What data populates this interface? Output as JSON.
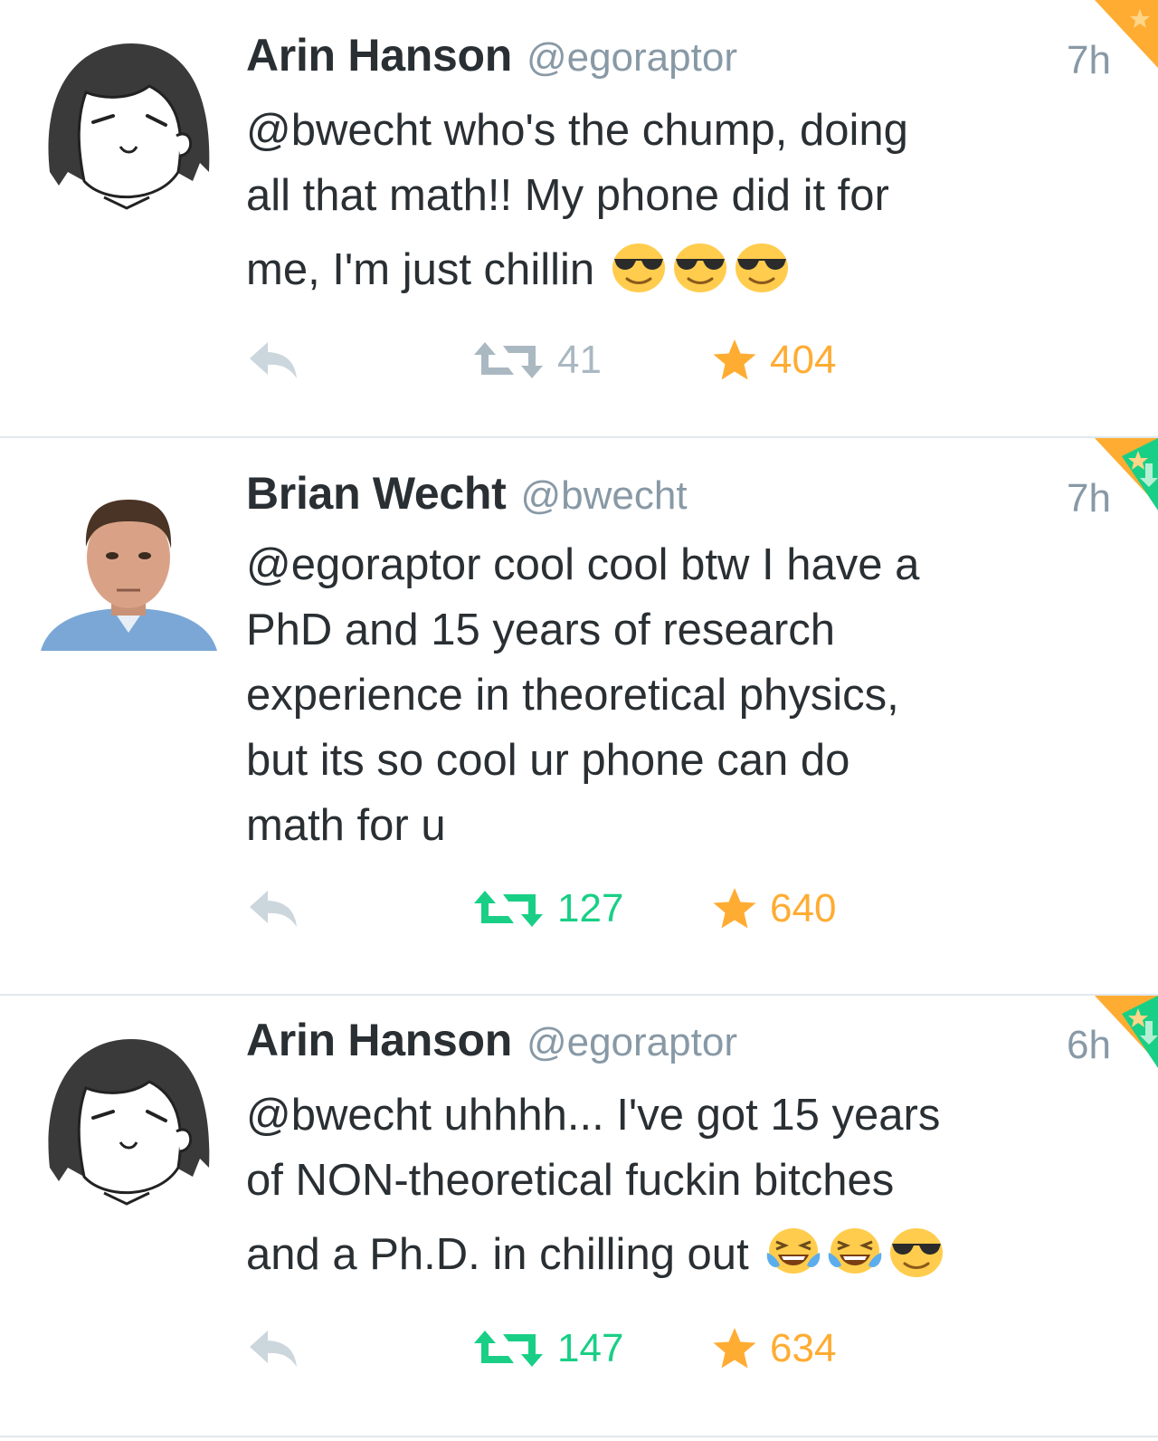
{
  "colors": {
    "name": "#292f33",
    "secondary": "#8899a6",
    "retweet_active": "#19cf86",
    "retweet_inactive": "#aab8c2",
    "favorite": "#ffac33",
    "divider": "#e1e8ed"
  },
  "tweets": [
    {
      "author_name": "Arin Hanson",
      "author_handle": "@egoraptor",
      "time": "7h",
      "text_lines": [
        "@bwecht who's the chump, doing",
        "all that math!! My phone did it for",
        "me, I'm just chillin"
      ],
      "emojis": [
        "sunglasses-emoji",
        "sunglasses-emoji",
        "sunglasses-emoji"
      ],
      "retweet_count": "41",
      "retweeted": false,
      "favorite_count": "404",
      "favorited": true,
      "avatar": "cartoon-avatar",
      "corner_badges": [
        "favorite-corner-badge"
      ]
    },
    {
      "author_name": "Brian Wecht",
      "author_handle": "@bwecht",
      "time": "7h",
      "text_lines": [
        "@egoraptor cool cool btw I have a",
        "PhD and 15 years of research",
        "experience in theoretical physics,",
        "but its so cool ur phone can do",
        "math for u"
      ],
      "emojis": [],
      "retweet_count": "127",
      "retweeted": true,
      "favorite_count": "640",
      "favorited": true,
      "avatar": "photo-avatar",
      "corner_badges": [
        "favorite-corner-badge",
        "retweet-corner-badge"
      ]
    },
    {
      "author_name": "Arin Hanson",
      "author_handle": "@egoraptor",
      "time": "6h",
      "text_lines": [
        "@bwecht uhhhh... I've got 15 years",
        "of NON-theoretical fuckin bitches",
        "and a Ph.D. in chilling out"
      ],
      "emojis": [
        "tears-of-joy-emoji",
        "tears-of-joy-emoji",
        "sunglasses-emoji"
      ],
      "retweet_count": "147",
      "retweeted": true,
      "favorite_count": "634",
      "favorited": true,
      "avatar": "cartoon-avatar",
      "corner_badges": [
        "favorite-corner-badge",
        "retweet-corner-badge"
      ]
    }
  ]
}
